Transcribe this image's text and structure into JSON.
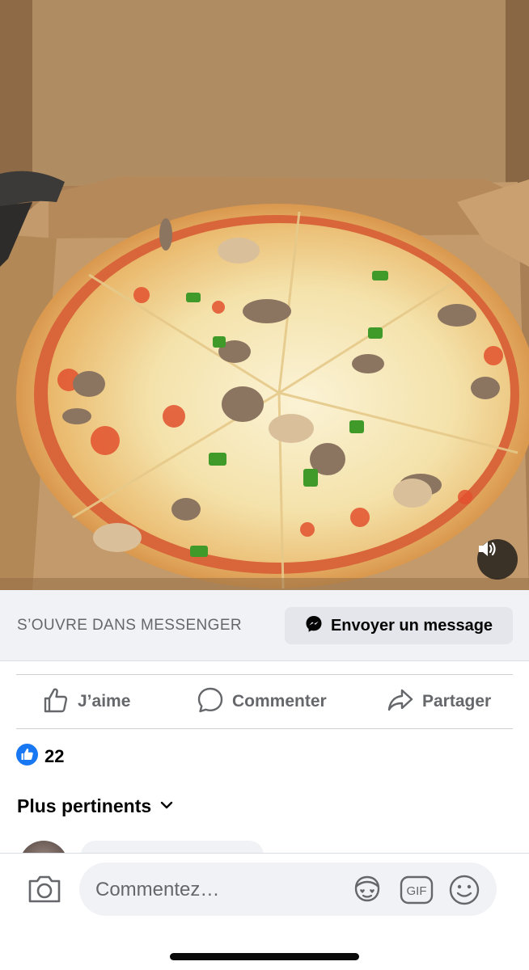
{
  "media": {
    "icon": "speaker-icon",
    "description_hidden": ""
  },
  "cta": {
    "label": "S’OUVRE DANS MESSENGER",
    "button_label": "Envoyer un message",
    "button_icon": "messenger-icon"
  },
  "actions": {
    "like_label": "J’aime",
    "comment_label": "Commenter",
    "share_label": "Partager"
  },
  "reactions": {
    "count": "22",
    "icon": "like-reaction-icon",
    "color": "#1877f2"
  },
  "comments": {
    "sort_label": "Plus pertinents",
    "placeholder": "Commentez…",
    "gif_label": "GIF"
  },
  "colors": {
    "accent": "#1877f2",
    "muted_text": "#65676b",
    "surface": "#f0f2f5"
  }
}
